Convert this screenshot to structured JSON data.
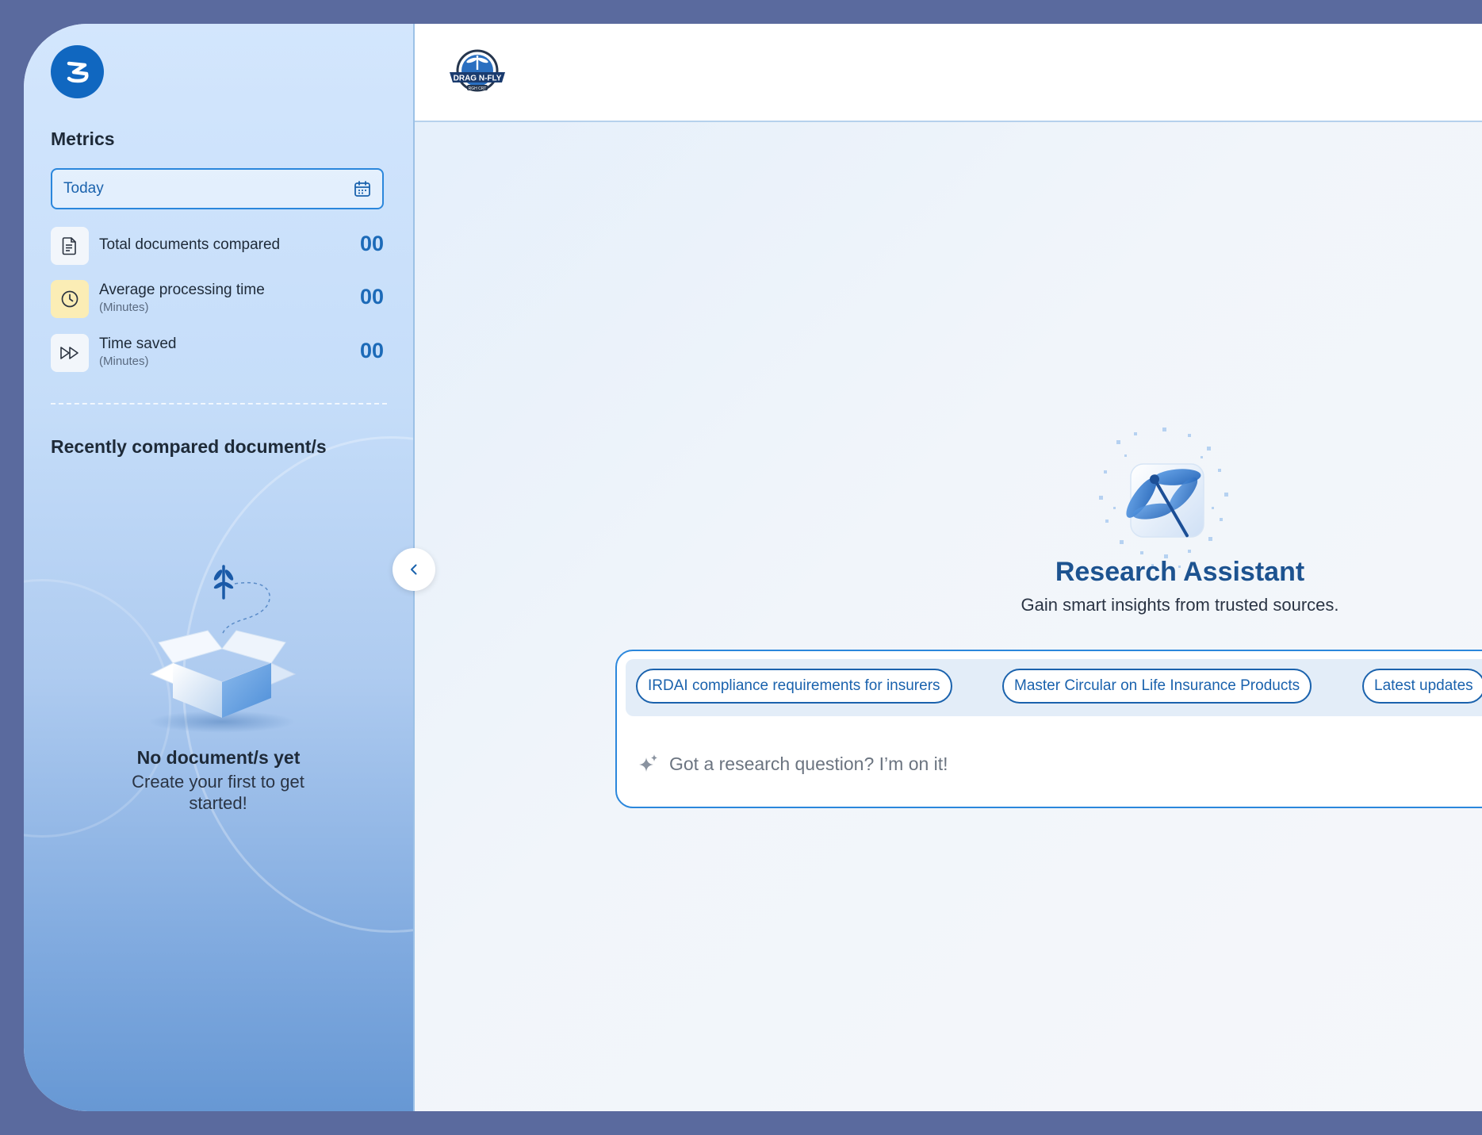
{
  "sidebar": {
    "metrics_title": "Metrics",
    "date_filter": {
      "value": "Today"
    },
    "metrics": [
      {
        "label": "Total documents compared",
        "sublabel": "",
        "value": "00",
        "icon": "document-icon"
      },
      {
        "label": "Average processing time",
        "sublabel": "(Minutes)",
        "value": "00",
        "icon": "clock-icon"
      },
      {
        "label": "Time saved",
        "sublabel": "(Minutes)",
        "value": "00",
        "icon": "fast-forward-icon"
      }
    ],
    "recent_title": "Recently compared document/s",
    "empty_state": {
      "title": "No document/s yet",
      "subtitle": "Create your first to get started!"
    }
  },
  "main": {
    "hero": {
      "title": "Research Assistant",
      "subtitle": "Gain smart insights from trusted sources."
    },
    "suggestions": [
      "IRDAI compliance requirements for insurers",
      "Master Circular on Life Insurance Products",
      "Latest updates"
    ],
    "query": {
      "placeholder": "Got a research question? I’m on it!",
      "value": ""
    }
  },
  "colors": {
    "accent": "#1a62ad",
    "frame": "#5a6a9e",
    "metric_value": "#1c6ab8",
    "clock_icon_bg": "#fbedb5"
  }
}
